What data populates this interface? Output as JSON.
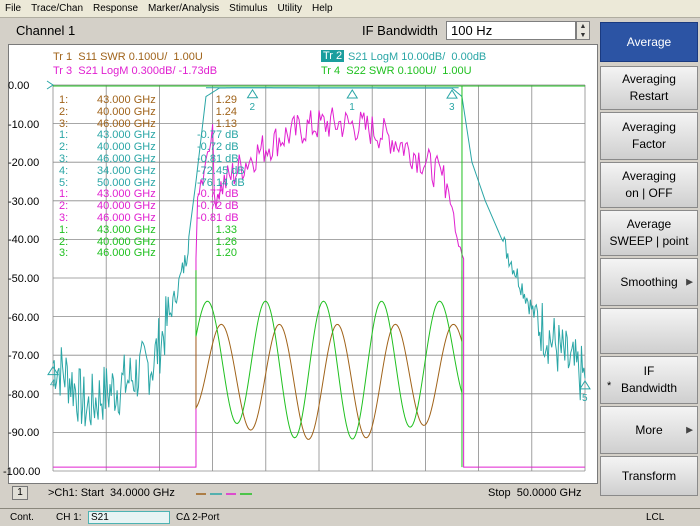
{
  "menu": [
    "File",
    "Trace/Chan",
    "Response",
    "Marker/Analysis",
    "Stimulus",
    "Utility",
    "Help"
  ],
  "top": {
    "channel_title": "Channel 1",
    "ifbw_label": "IF Bandwidth",
    "ifbw_value": "100 Hz"
  },
  "traces": {
    "tr1": "Tr 1  S11 SWR 0.100U/  1.00U",
    "tr2_box": "Tr 2",
    "tr2": " S21 LogM 10.00dB/  0.00dB",
    "tr3": "Tr 3  S21 LogM 0.300dB/ -1.73dB",
    "tr4": "Tr 4  S22 SWR 0.100U/  1.00U"
  },
  "colors": {
    "tr1": "#a0631a",
    "tr2": "#2aa6a6",
    "tr3": "#e020d0",
    "tr4": "#20c020",
    "active_key": "#2c54a4"
  },
  "yaxis": [
    "0.00",
    "-10.00",
    "-20.00",
    "-30.00",
    "-40.00",
    "-50.00",
    "-60.00",
    "-70.00",
    "-80.00",
    "-90.00",
    "-100.00"
  ],
  "marker_rows": [
    {
      "n": "1:",
      "f": "43.000 GHz",
      "v": "1.29",
      "tr": "tr1"
    },
    {
      "n": "2:",
      "f": "40.000 GHz",
      "v": "1.24",
      "tr": "tr1"
    },
    {
      "n": "3:",
      "f": "46.000 GHz",
      "v": "1.13",
      "tr": "tr1"
    },
    {
      "n": "1:",
      "f": "43.000 GHz",
      "v": "-0.77 dB",
      "tr": "tr2"
    },
    {
      "n": "2:",
      "f": "40.000 GHz",
      "v": "-0.72 dB",
      "tr": "tr2"
    },
    {
      "n": "3:",
      "f": "46.000 GHz",
      "v": "-0.81 dB",
      "tr": "tr2"
    },
    {
      "n": "4:",
      "f": "34.000 GHz",
      "v": "-72.45 dB",
      "tr": "tr2"
    },
    {
      "n": "5:",
      "f": "50.000 GHz",
      "v": "-76.14 dB",
      "tr": "tr2"
    },
    {
      "n": "1:",
      "f": "43.000 GHz",
      "v": "-0.77 dB",
      "tr": "tr3"
    },
    {
      "n": "2:",
      "f": "40.000 GHz",
      "v": "-0.72 dB",
      "tr": "tr3"
    },
    {
      "n": "3:",
      "f": "46.000 GHz",
      "v": "-0.81 dB",
      "tr": "tr3"
    },
    {
      "n": "1:",
      "f": "43.000 GHz",
      "v": "1.33",
      "tr": "tr4"
    },
    {
      "n": "2:",
      "f": "40.000 GHz",
      "v": "1.26",
      "tr": "tr4"
    },
    {
      "n": "3:",
      "f": "46.000 GHz",
      "v": "1.20",
      "tr": "tr4"
    }
  ],
  "bottom": {
    "ch_num": "1",
    "start": ">Ch1: Start  34.0000 GHz",
    "stop": "Stop  50.0000 GHz"
  },
  "status": {
    "mode": "Cont.",
    "ch": "CH 1:",
    "param": "S21",
    "cal": "CΔ 2-Port",
    "ref": "LCL"
  },
  "softkeys": [
    {
      "label": "Average",
      "active": true
    },
    {
      "label": "Averaging\nRestart"
    },
    {
      "label": "Averaging\nFactor"
    },
    {
      "label": "Averaging\non | OFF"
    },
    {
      "label": "Average\nSWEEP | point"
    },
    {
      "label": "Smoothing",
      "arrow": true
    },
    {
      "label": ""
    },
    {
      "label": "IF\nBandwidth",
      "star": "*"
    },
    {
      "label": "More",
      "arrow": true
    },
    {
      "label": "Transform"
    }
  ],
  "chart_data": {
    "type": "line",
    "x_range": [
      34,
      50
    ],
    "x_unit": "GHz",
    "y_range": [
      -100,
      0
    ],
    "y_unit": "dB",
    "series": [
      {
        "name": "Tr 2",
        "x": [
          34,
          34.5,
          35,
          35.5,
          36,
          36.5,
          37,
          37.5,
          38,
          38.3,
          38.6,
          39,
          39.5,
          40,
          41,
          42,
          43,
          44,
          45,
          46,
          46.3,
          46.6,
          47,
          47.5,
          48,
          48.5,
          49,
          49.5,
          50
        ],
        "values": [
          -72,
          -76,
          -84,
          -80,
          -78,
          -75,
          -72,
          -60,
          -45,
          -25,
          -3,
          -0.8,
          -0.7,
          -0.7,
          -0.75,
          -0.78,
          -0.77,
          -0.8,
          -0.8,
          -0.81,
          -3,
          -20,
          -30,
          -40,
          -50,
          -60,
          -66,
          -72,
          -76
        ]
      }
    ],
    "markers": [
      {
        "label": "1",
        "x": 43,
        "y": -0.77
      },
      {
        "label": "2",
        "x": 40,
        "y": -0.72
      },
      {
        "label": "3",
        "x": 46,
        "y": -0.81
      },
      {
        "label": "4",
        "x": 34,
        "y": -72.45
      },
      {
        "label": "5",
        "x": 50,
        "y": -76.14
      }
    ]
  }
}
